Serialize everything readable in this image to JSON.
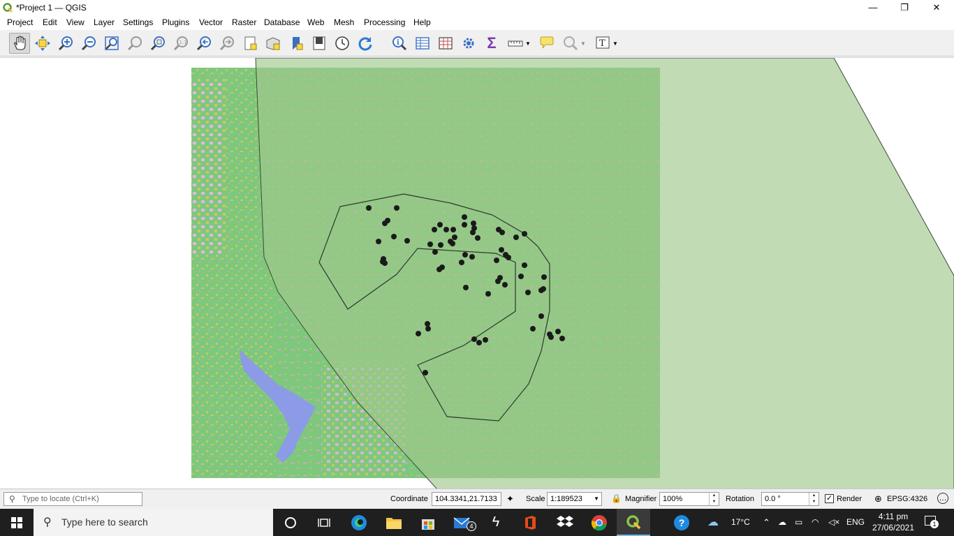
{
  "window": {
    "title": "*Project 1 — QGIS",
    "minimize_glyph": "—",
    "restore_glyph": "❐",
    "close_glyph": "✕"
  },
  "menu": [
    "Project",
    "Edit",
    "View",
    "Layer",
    "Settings",
    "Plugins",
    "Vector",
    "Raster",
    "Database",
    "Web",
    "Mesh",
    "Processing",
    "Help"
  ],
  "toolbar": {
    "icons": [
      "pan-icon",
      "pan-to-selection-icon",
      "zoom-in-icon",
      "zoom-out-icon",
      "zoom-full-icon",
      "zoom-to-selection-icon",
      "zoom-to-layer-icon",
      "zoom-native-icon",
      "zoom-last-icon",
      "zoom-next-icon",
      "new-bookmark-icon",
      "show-bookmarks-icon",
      "new-spatial-bookmark-icon",
      "map-tips-icon",
      "temporal-controller-icon",
      "refresh-icon",
      "identify-icon",
      "attribute-table-icon",
      "statistical-summary-icon",
      "settings-gear-icon",
      "sum-icon",
      "measure-icon",
      "annotation-icon",
      "select-icon",
      "text-annotation-icon"
    ],
    "text_annotation_glyph": "T",
    "sum_glyph": "Σ"
  },
  "map": {
    "raster_colors": {
      "forest": "#7dc87d",
      "cropland": "#c8c864",
      "builtup": "#e6b4e6",
      "water": "#8c9be6",
      "bare": "#b4b4a0"
    },
    "overlay_color": "#a0c88c",
    "point_color": "#1a1a1a"
  },
  "status": {
    "locate_placeholder": "Type to locate (Ctrl+K)",
    "coordinate_label": "Coordinate",
    "coordinate_value": "104.3341,21.7133",
    "scale_label": "Scale",
    "scale_value": "1:189523",
    "magnifier_label": "Magnifier",
    "magnifier_value": "100%",
    "rotation_label": "Rotation",
    "rotation_value": "0.0 °",
    "render_label": "Render",
    "render_checked": "✓",
    "crs": "EPSG:4326"
  },
  "taskbar": {
    "search_placeholder": "Type here to search",
    "mail_badge": "4",
    "weather": "17°C",
    "language": "ENG",
    "time": "4:11 pm",
    "date": "27/06/2021",
    "notification_count": "1"
  }
}
